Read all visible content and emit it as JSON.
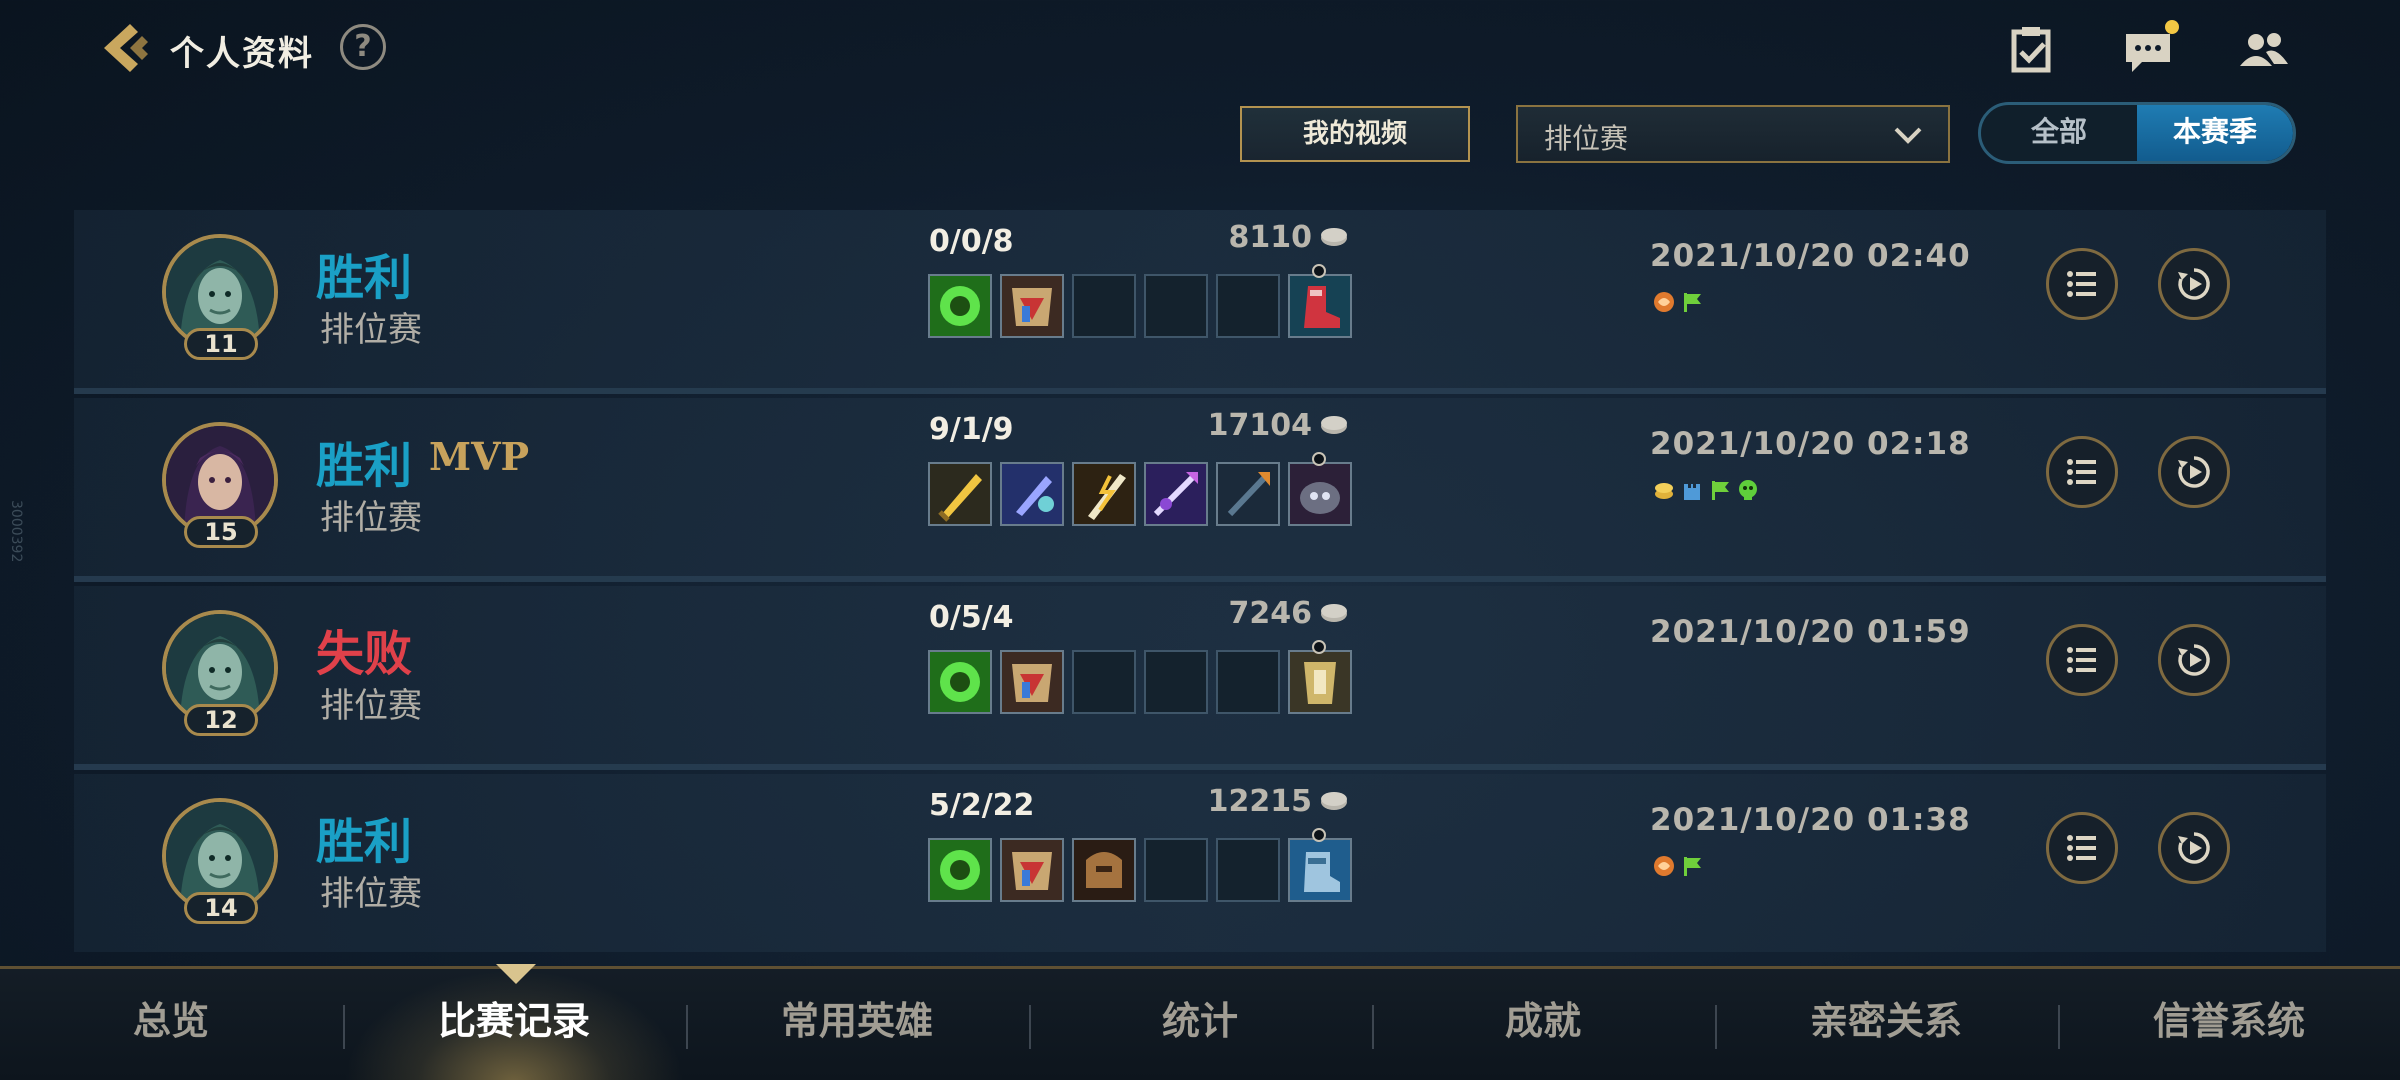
{
  "header": {
    "title": "个人资料",
    "help_label": "?",
    "icons": [
      "task-checklist-icon",
      "chat-bubble-icon",
      "friends-icon"
    ]
  },
  "filters": {
    "video_button": "我的视频",
    "mode_select": "排位赛",
    "season_toggle": {
      "all": "全部",
      "season": "本赛季",
      "selected": "本赛季"
    }
  },
  "matches": [
    {
      "result": "胜利",
      "mvp": "",
      "mode": "排位赛",
      "level": "11",
      "kda": "0/0/8",
      "gold": "8110",
      "date": "2021/10/20 02:40",
      "items": [
        "emerald-item",
        "gauntlet-item",
        "",
        "",
        "",
        "red-boots-item"
      ],
      "badges": [
        "orange-badge",
        "green-flag-badge"
      ]
    },
    {
      "result": "胜利",
      "mvp": "MVP",
      "mode": "排位赛",
      "level": "15",
      "kda": "9/1/9",
      "gold": "17104",
      "date": "2021/10/20 02:18",
      "items": [
        "golden-blade-item",
        "violet-blade-item",
        "lightning-sword-item",
        "purple-spear-item",
        "dark-spear-item",
        "armor-boots-item"
      ],
      "badges": [
        "coins-badge",
        "tower-badge",
        "green-flag-badge",
        "green-skull-badge"
      ]
    },
    {
      "result": "失败",
      "mvp": "",
      "mode": "排位赛",
      "level": "12",
      "kda": "0/5/4",
      "gold": "7246",
      "date": "2021/10/20 01:59",
      "items": [
        "emerald-item",
        "gauntlet-item",
        "",
        "",
        "",
        "gold-boots-item"
      ],
      "badges": []
    },
    {
      "result": "胜利",
      "mvp": "",
      "mode": "排位赛",
      "level": "14",
      "kda": "5/2/22",
      "gold": "12215",
      "date": "2021/10/20 01:38",
      "items": [
        "emerald-item",
        "gauntlet-item",
        "bronze-armor-item",
        "",
        "",
        "blue-boots-item"
      ],
      "badges": [
        "orange-badge",
        "green-flag-badge"
      ]
    }
  ],
  "nav": {
    "tabs": [
      "总览",
      "比赛记录",
      "常用英雄",
      "统计",
      "成就",
      "亲密关系",
      "信誉系统"
    ],
    "active_index": 1
  },
  "colors": {
    "win": "#1aa0c6",
    "loss": "#e0414a",
    "accent": "#a88a4d",
    "mvp": "#c7a25c"
  },
  "side_label": "3000392"
}
